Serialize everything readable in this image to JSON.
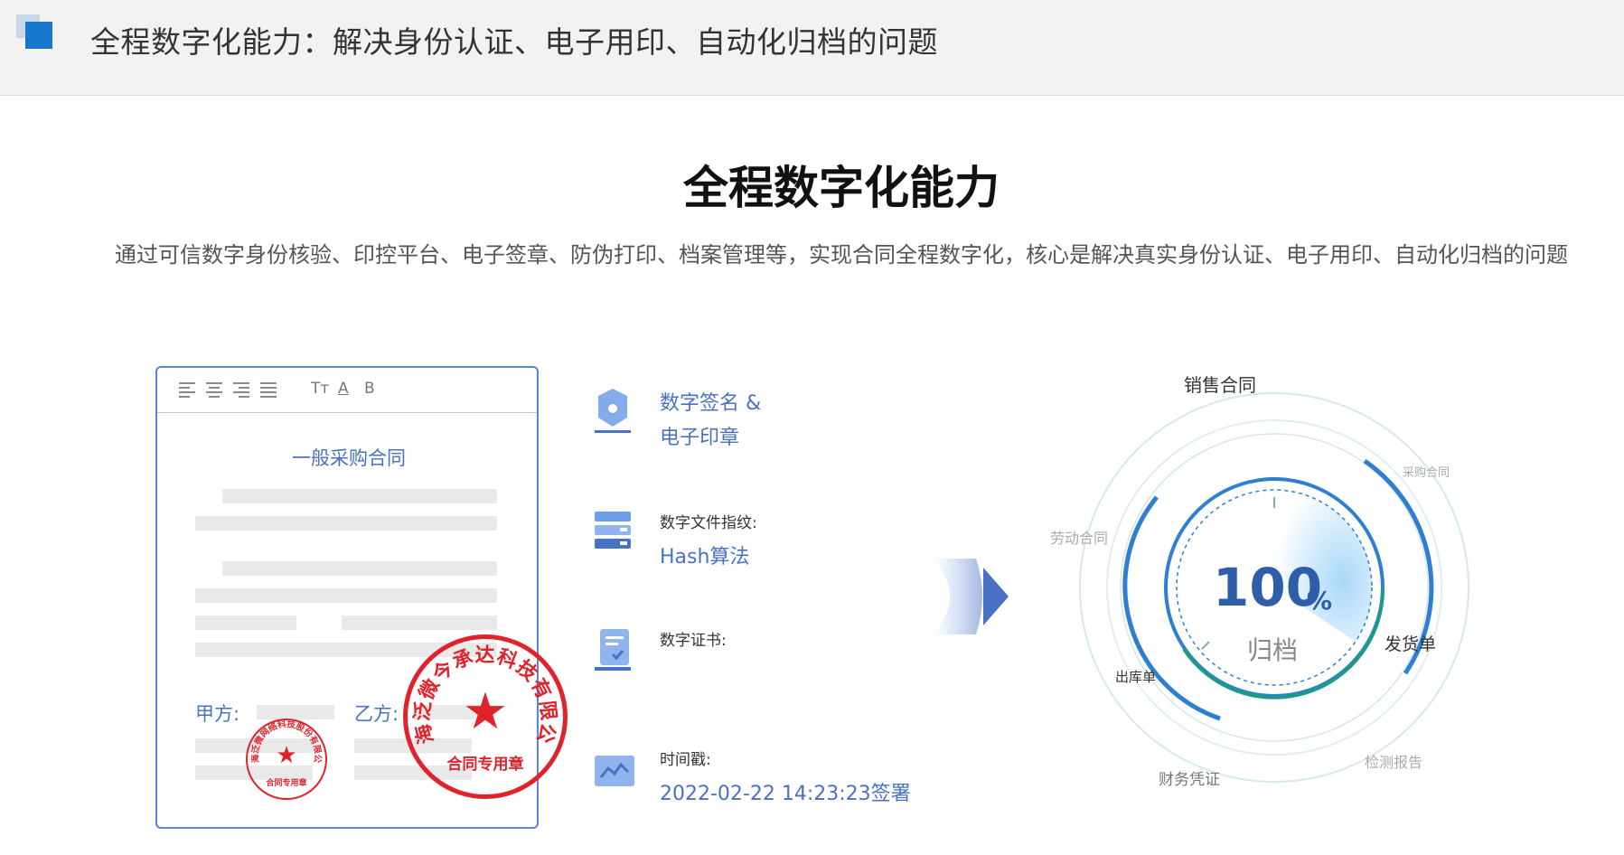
{
  "header": {
    "title": "全程数字化能力：解决身份认证、电子用印、自动化归档的问题"
  },
  "main": {
    "title": "全程数字化能力",
    "subtitle": "通过可信数字身份核验、印控平台、电子签章、防伪打印、档案管理等，实现合同全程数字化，核心是解决真实身份认证、电子用印、自动化归档的问题"
  },
  "doc": {
    "toolbar": {
      "font_size": "Tт",
      "font_color": "A",
      "bold": "B"
    },
    "title": "一般采购合同",
    "party_a": "甲方:",
    "party_b": "乙方:",
    "seal_small": {
      "ring_text": "上海泛微网络科技股份有限公司",
      "foot": "合同专用章"
    },
    "seal_large": {
      "ring_text": "上海泛微今承达科技有限公司",
      "foot": "合同专用章"
    }
  },
  "features": [
    {
      "icon": "pen-nib-icon",
      "label": "数字签名 &",
      "value": "电子印章"
    },
    {
      "icon": "fingerprint-server-icon",
      "label": "数字文件指纹:",
      "value": "Hash算法"
    },
    {
      "icon": "certificate-icon",
      "label": "数字证书:",
      "value": ""
    },
    {
      "icon": "timestamp-icon",
      "label": "时间戳:",
      "value": "2022-02-22 14:23:23签署"
    }
  ],
  "archive": {
    "percent": "100",
    "percent_sign": "%",
    "center_label": "归档",
    "labels": {
      "top": "销售合同",
      "top_right": "采购合同",
      "left": "劳动合同",
      "right": "发货单",
      "inner_left": "出库单",
      "bottom_left": "财务凭证",
      "bottom_right": "检测报告"
    }
  },
  "colors": {
    "accent": "#4a72c4",
    "seal_red": "#e0232b",
    "ring_blue": "#2f7fd1",
    "ring_teal": "#1a9a8a"
  }
}
